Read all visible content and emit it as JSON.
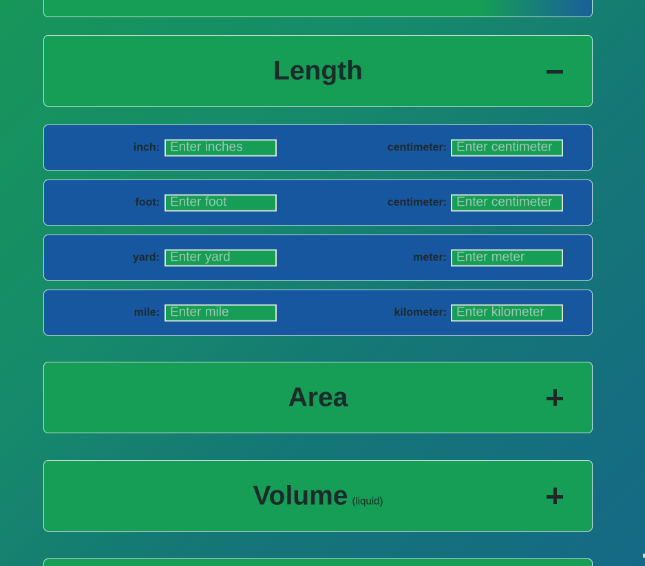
{
  "sections": {
    "length": {
      "title": "Length",
      "toggle": "collapse",
      "rows": [
        {
          "left_label": "inch:",
          "left_placeholder": "Enter inches",
          "right_label": "centimeter:",
          "right_placeholder": "Enter centimeter"
        },
        {
          "left_label": "foot:",
          "left_placeholder": "Enter foot",
          "right_label": "centimeter:",
          "right_placeholder": "Enter centimeter"
        },
        {
          "left_label": "yard:",
          "left_placeholder": "Enter yard",
          "right_label": "meter:",
          "right_placeholder": "Enter meter"
        },
        {
          "left_label": "mile:",
          "left_placeholder": "Enter mile",
          "right_label": "kilometer:",
          "right_placeholder": "Enter kilometer"
        }
      ]
    },
    "area": {
      "title": "Area",
      "toggle": "expand"
    },
    "volume": {
      "title": "Volume",
      "subtitle": "(liquid)",
      "toggle": "expand"
    }
  },
  "colors": {
    "header_green": "#169d56",
    "row_blue": "#1757a0",
    "text_dark": "#1b2b2a"
  }
}
